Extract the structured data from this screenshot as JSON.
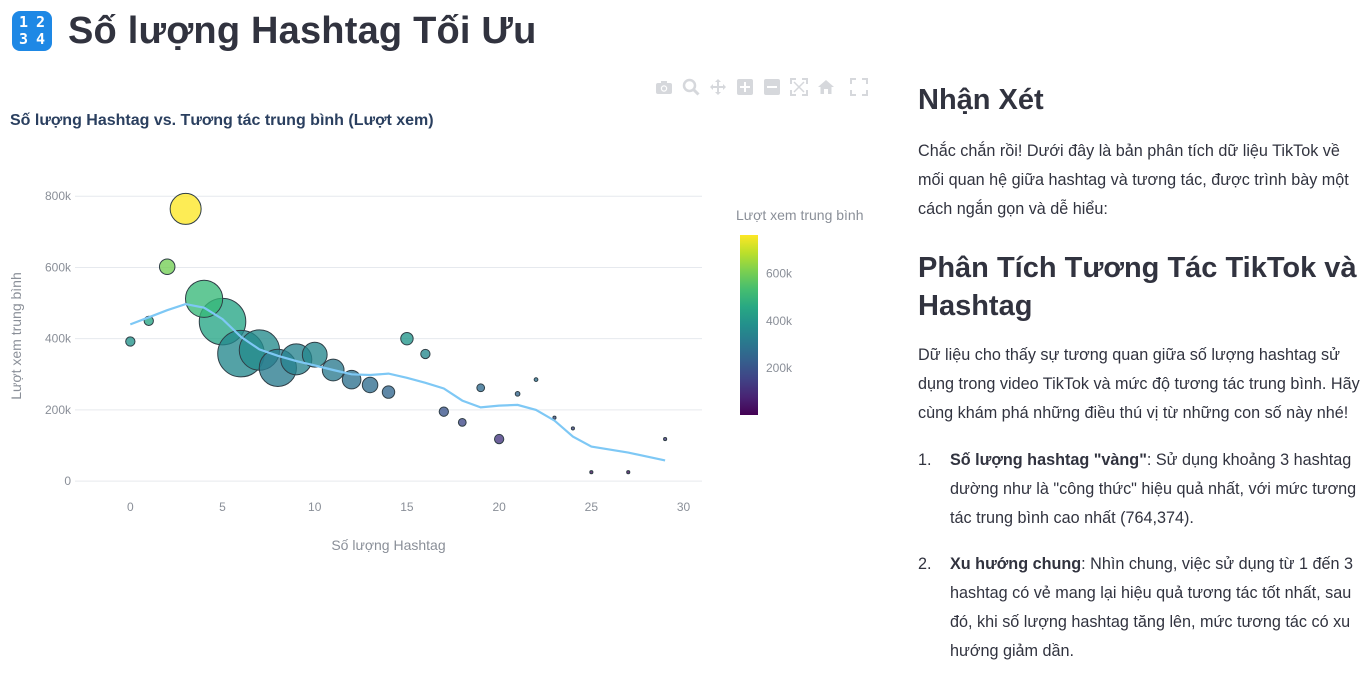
{
  "header": {
    "icon_digits": [
      "1",
      "2",
      "3",
      "4"
    ],
    "title": "Số lượng Hashtag Tối Ưu"
  },
  "modebar": {
    "icons": [
      "camera-icon",
      "zoom-icon",
      "pan-icon",
      "zoom-in-icon",
      "zoom-out-icon",
      "autoscale-icon",
      "reset-axes-icon",
      "fullscreen-icon"
    ]
  },
  "chart_data": {
    "type": "scatter",
    "title": "Số lượng Hashtag vs. Tương tác trung bình (Lượt xem)",
    "xlabel": "Số lượng Hashtag",
    "ylabel": "Lượt xem trung bình",
    "xlim": [
      -3,
      31
    ],
    "ylim": [
      -25000,
      840000
    ],
    "xticks": [
      0,
      5,
      10,
      15,
      20,
      25,
      30
    ],
    "xtick_labels": [
      "0",
      "5",
      "10",
      "15",
      "20",
      "25",
      "30"
    ],
    "yticks": [
      0,
      200000,
      400000,
      600000,
      800000
    ],
    "ytick_labels": [
      "0",
      "200k",
      "400k",
      "600k",
      "800k"
    ],
    "colorbar": {
      "title": "Lượt xem trung bình",
      "ticks": [
        200000,
        400000,
        600000
      ],
      "tick_labels": [
        "200k",
        "400k",
        "600k"
      ],
      "range": [
        0,
        764374
      ],
      "colorscale": "viridis"
    },
    "grid": true,
    "points": [
      {
        "x": 0,
        "y": 392000,
        "size": 3
      },
      {
        "x": 1,
        "y": 450000,
        "size": 3
      },
      {
        "x": 2,
        "y": 602000,
        "size": 5
      },
      {
        "x": 3,
        "y": 764374,
        "size": 10
      },
      {
        "x": 4,
        "y": 512000,
        "size": 12
      },
      {
        "x": 5,
        "y": 448000,
        "size": 15
      },
      {
        "x": 6,
        "y": 358000,
        "size": 15
      },
      {
        "x": 7,
        "y": 368000,
        "size": 13
      },
      {
        "x": 8,
        "y": 318000,
        "size": 12
      },
      {
        "x": 9,
        "y": 342000,
        "size": 10
      },
      {
        "x": 10,
        "y": 355000,
        "size": 8
      },
      {
        "x": 11,
        "y": 312000,
        "size": 7
      },
      {
        "x": 12,
        "y": 285000,
        "size": 6
      },
      {
        "x": 13,
        "y": 270000,
        "size": 5
      },
      {
        "x": 14,
        "y": 250000,
        "size": 4
      },
      {
        "x": 15,
        "y": 400000,
        "size": 4
      },
      {
        "x": 16,
        "y": 357000,
        "size": 3
      },
      {
        "x": 17,
        "y": 195000,
        "size": 3
      },
      {
        "x": 18,
        "y": 165000,
        "size": 2.5
      },
      {
        "x": 19,
        "y": 262000,
        "size": 2.5
      },
      {
        "x": 20,
        "y": 118000,
        "size": 3
      },
      {
        "x": 21,
        "y": 245000,
        "size": 1.5
      },
      {
        "x": 22,
        "y": 285000,
        "size": 1.2
      },
      {
        "x": 23,
        "y": 178000,
        "size": 1
      },
      {
        "x": 24,
        "y": 148000,
        "size": 1
      },
      {
        "x": 25,
        "y": 25000,
        "size": 1
      },
      {
        "x": 27,
        "y": 25000,
        "size": 1
      },
      {
        "x": 29,
        "y": 118000,
        "size": 1
      }
    ],
    "trend": {
      "x": [
        0,
        1,
        2,
        3,
        4,
        5,
        6,
        7,
        8,
        9,
        10,
        11,
        12,
        13,
        14,
        15,
        16,
        17,
        18,
        19,
        20,
        21,
        22,
        23,
        24,
        25,
        27,
        29
      ],
      "y": [
        440000,
        460000,
        480000,
        497000,
        487000,
        455000,
        405000,
        370000,
        352000,
        337000,
        325000,
        312000,
        300000,
        298000,
        302000,
        290000,
        276000,
        260000,
        226000,
        207000,
        212000,
        214000,
        200000,
        170000,
        125000,
        97000,
        80000,
        58000
      ]
    }
  },
  "right": {
    "heading1": "Nhận Xét",
    "intro": "Chắc chắn rồi! Dưới đây là bản phân tích dữ liệu TikTok về mối quan hệ giữa hashtag và tương tác, được trình bày một cách ngắn gọn và dễ hiểu:",
    "heading2": "Phân Tích Tương Tác TikTok và Hashtag",
    "para": "Dữ liệu cho thấy sự tương quan giữa số lượng hashtag sử dụng trong video TikTok và mức độ tương tác trung bình. Hãy cùng khám phá những điều thú vị từ những con số này nhé!",
    "items": [
      {
        "num": "1.",
        "bold": "Số lượng hashtag \"vàng\"",
        "text": ": Sử dụng khoảng 3 hashtag dường như là \"công thức\" hiệu quả nhất, với mức tương tác trung bình cao nhất (764,374)."
      },
      {
        "num": "2.",
        "bold": "Xu hướng chung",
        "text": ": Nhìn chung, việc sử dụng từ 1 đến 3 hashtag có vẻ mang lại hiệu quả tương tác tốt nhất, sau đó, khi số lượng hashtag tăng lên, mức tương tác có xu hướng giảm dần."
      }
    ]
  },
  "colors": {
    "text": "#31333f",
    "axis_text": "#8a8f98",
    "grid": "#e6e9ee",
    "trend": "#7ec8f5",
    "icon_blue": "#1e88e5"
  }
}
